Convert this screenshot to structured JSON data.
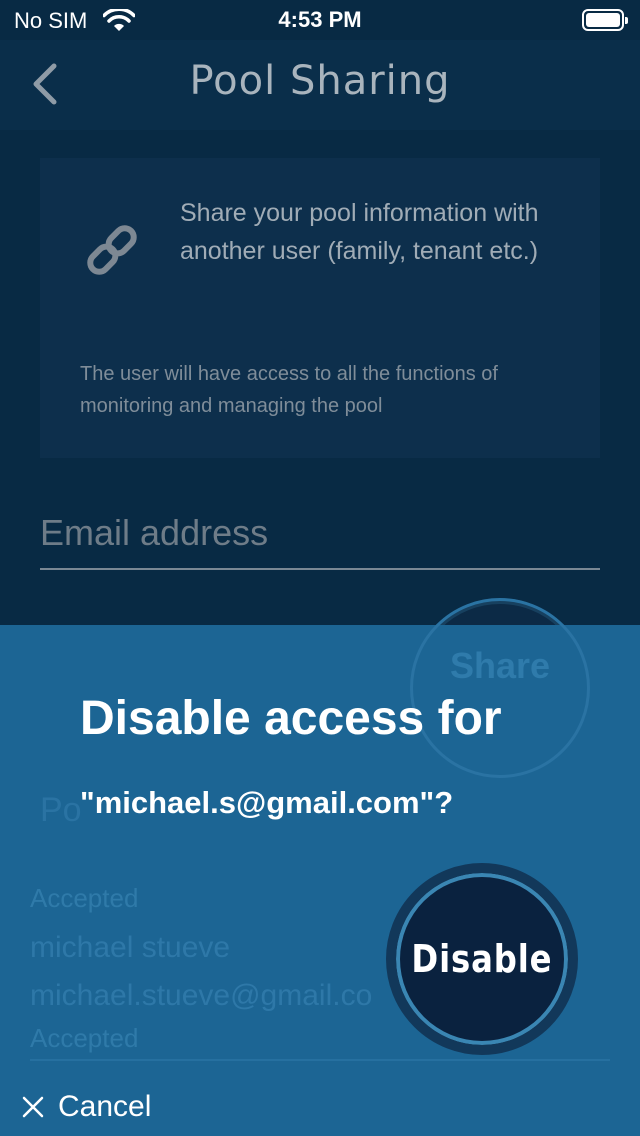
{
  "status_bar": {
    "carrier": "No SIM",
    "time": "4:53 PM"
  },
  "nav": {
    "title": "Pool Sharing",
    "back_icon": "chevron-left-icon"
  },
  "info_card": {
    "icon": "link-icon",
    "heading": "Share your pool information with another user (family, tenant etc.)",
    "note": "The user will have access to all the functions of monitoring and managing the pool"
  },
  "email": {
    "placeholder": "Email address",
    "value": ""
  },
  "background": {
    "share_label": "Share",
    "pool_title": "Po",
    "accepted_label_1": "Accepted",
    "user_name": "michael stueve",
    "user_email": "michael.stueve@gmail.co",
    "accepted_label_2": "Accepted"
  },
  "dialog": {
    "title": "Disable access for",
    "email_line": "\"michael.s@gmail.com\"?",
    "confirm_label": "Disable",
    "cancel_label": "Cancel",
    "cancel_icon": "close-icon"
  },
  "colors": {
    "background": "#082a44",
    "overlay": "#1c6594",
    "button": "#0a223f"
  }
}
